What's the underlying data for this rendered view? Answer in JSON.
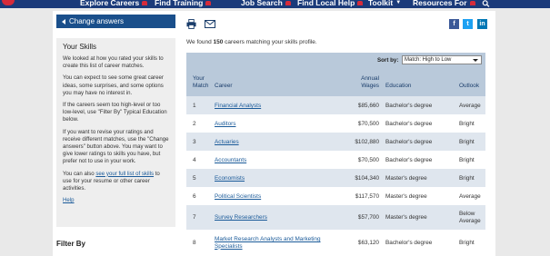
{
  "nav": {
    "items": [
      {
        "label": "Explore Careers",
        "marker": "heart"
      },
      {
        "label": "Find Training",
        "marker": "heart"
      },
      {
        "label": "Job Search",
        "marker": "heart"
      },
      {
        "label": "Find Local Help",
        "marker": "heart"
      },
      {
        "label": "Toolkit",
        "marker": "chevron"
      },
      {
        "label": "Resources For",
        "marker": "heart"
      }
    ],
    "search_icon": "search-icon"
  },
  "sidebar": {
    "change_answers": "Change answers",
    "skills": {
      "title": "Your Skills",
      "p1": "We looked at how you rated your skills to create this list of career matches.",
      "p2": "You can expect to see some great career ideas, some surprises, and some options you may have no interest in.",
      "p3": "If the careers seem too high-level or too low-level, use \"Filter By\" Typical Education below.",
      "p4": "If you want to revise your ratings and receive different matches, use the \"Change answers\" button above. You may want to give lower ratings to skills you have, but prefer not to use in your work.",
      "p5_prefix": "You can also ",
      "p5_link": "see your full list of skills",
      "p5_suffix": " to use for your resume or other career activities.",
      "help": "Help"
    },
    "filter_by": "Filter By"
  },
  "main": {
    "found_prefix": "We found ",
    "found_count": "150",
    "found_suffix": " careers matching your skills profile.",
    "sort_label": "Sort by:",
    "sort_value": "Match: High to Low",
    "headers": {
      "match_line1": "Your",
      "match_line2": "Match",
      "career": "Career",
      "wages_line1": "Annual",
      "wages_line2": "Wages",
      "education": "Education",
      "outlook": "Outlook"
    },
    "rows": [
      {
        "num": "1",
        "career": "Financial Analysts",
        "career2": "",
        "wage": "$85,660",
        "edu": "Bachelor's degree",
        "outlook": "Average",
        "outlook2": ""
      },
      {
        "num": "2",
        "career": "Auditors",
        "career2": "",
        "wage": "$70,500",
        "edu": "Bachelor's degree",
        "outlook": "Bright",
        "outlook2": ""
      },
      {
        "num": "3",
        "career": "Actuaries",
        "career2": "",
        "wage": "$102,880",
        "edu": "Bachelor's degree",
        "outlook": "Bright",
        "outlook2": ""
      },
      {
        "num": "4",
        "career": "Accountants",
        "career2": "",
        "wage": "$70,500",
        "edu": "Bachelor's degree",
        "outlook": "Bright",
        "outlook2": ""
      },
      {
        "num": "5",
        "career": "Economists",
        "career2": "",
        "wage": "$104,340",
        "edu": "Master's degree",
        "outlook": "Bright",
        "outlook2": ""
      },
      {
        "num": "6",
        "career": "Political Scientists",
        "career2": "",
        "wage": "$117,570",
        "edu": "Master's degree",
        "outlook": "Average",
        "outlook2": ""
      },
      {
        "num": "7",
        "career": "Survey Researchers",
        "career2": "",
        "wage": "$57,700",
        "edu": "Master's degree",
        "outlook": "Below",
        "outlook2": "Average"
      },
      {
        "num": "8",
        "career": "Market Research Analysts and Marketing",
        "career2": "Specialists",
        "wage": "$63,120",
        "edu": "Bachelor's degree",
        "outlook": "Bright",
        "outlook2": ""
      }
    ]
  },
  "share": {
    "facebook": "f",
    "twitter": "t",
    "linkedin": "in"
  },
  "colors": {
    "nav_bg": "#1b3b7a",
    "accent_red": "#d62b3a",
    "button_blue": "#1a4f8b",
    "table_header": "#b9c9da",
    "row_alt": "#dfe6ee",
    "link": "#1a5a99"
  }
}
